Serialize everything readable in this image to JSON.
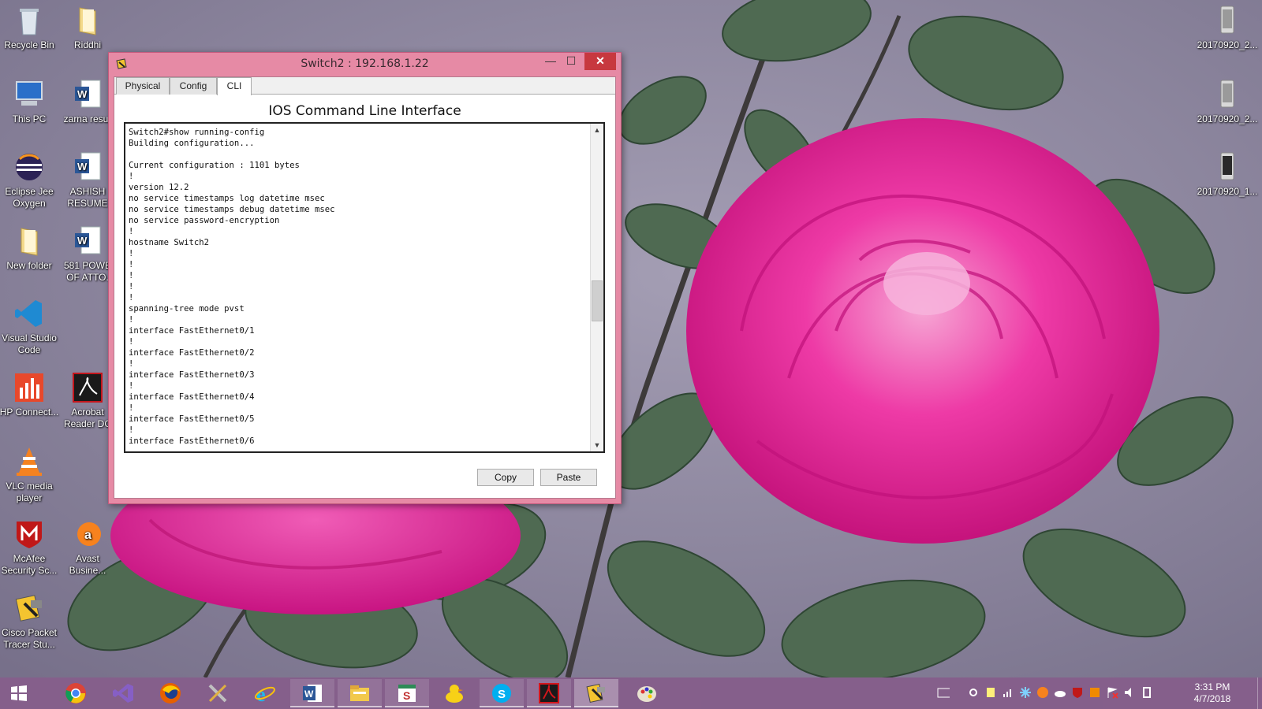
{
  "desktop": {
    "left_icons": [
      {
        "label": "Recycle Bin",
        "icon": "recycle-bin-icon"
      },
      {
        "label": "Riddhi",
        "icon": "folder-icon"
      },
      {
        "label": "This PC",
        "icon": "computer-icon"
      },
      {
        "label": "zarna resur",
        "icon": "word-document-icon"
      },
      {
        "label": "Eclipse Jee Oxygen",
        "icon": "eclipse-icon"
      },
      {
        "label": "ASHISH RESUME",
        "icon": "word-document-icon"
      },
      {
        "label": "New folder",
        "icon": "folder-icon"
      },
      {
        "label": "581 POWE OF ATTO.",
        "icon": "word-document-icon"
      },
      {
        "label": "Visual Studio Code",
        "icon": "vscode-icon"
      },
      {
        "label": "HP Connect...",
        "icon": "hp-connect-icon"
      },
      {
        "label": "Acrobat Reader DC",
        "icon": "acrobat-icon"
      },
      {
        "label": "VLC media player",
        "icon": "vlc-icon"
      },
      {
        "label": "McAfee Security Sc...",
        "icon": "mcafee-icon"
      },
      {
        "label": "Avast Busine...",
        "icon": "avast-icon"
      },
      {
        "label": "Cisco Packet Tracer Stu...",
        "icon": "packet-tracer-icon"
      }
    ],
    "right_icons": [
      {
        "label": "20170920_2...",
        "icon": "image-file-icon"
      },
      {
        "label": "20170920_2...",
        "icon": "image-file-icon"
      },
      {
        "label": "20170920_1...",
        "icon": "image-file-icon"
      }
    ]
  },
  "window": {
    "title": "Switch2 : 192.168.1.22",
    "controls": {
      "minimize": "—",
      "maximize": "☐",
      "close": "✕"
    },
    "tabs": [
      {
        "label": "Physical"
      },
      {
        "label": "Config"
      },
      {
        "label": "CLI"
      }
    ],
    "active_tab": "CLI",
    "heading": "IOS Command Line Interface",
    "cli_output": "Switch2#show running-config\nBuilding configuration...\n\nCurrent configuration : 1101 bytes\n!\nversion 12.2\nno service timestamps log datetime msec\nno service timestamps debug datetime msec\nno service password-encryption\n!\nhostname Switch2\n!\n!\n!\n!\n!\nspanning-tree mode pvst\n!\ninterface FastEthernet0/1\n!\ninterface FastEthernet0/2\n!\ninterface FastEthernet0/3\n!\ninterface FastEthernet0/4\n!\ninterface FastEthernet0/5\n!\ninterface FastEthernet0/6",
    "scroll_position": 0.55,
    "copy_label": "Copy",
    "paste_label": "Paste"
  },
  "taskbar": {
    "items": [
      {
        "name": "start-button",
        "icon": "windows-icon"
      },
      {
        "name": "chrome",
        "icon": "chrome-icon"
      },
      {
        "name": "visual-studio",
        "icon": "visual-studio-icon"
      },
      {
        "name": "firefox",
        "icon": "firefox-icon"
      },
      {
        "name": "tools",
        "icon": "tools-icon"
      },
      {
        "name": "internet-explorer",
        "icon": "internet-explorer-icon"
      },
      {
        "name": "word",
        "icon": "word-icon"
      },
      {
        "name": "file-explorer",
        "icon": "file-explorer-icon"
      },
      {
        "name": "slides",
        "icon": "slides-icon"
      },
      {
        "name": "cyberduck",
        "icon": "duck-icon"
      },
      {
        "name": "skype",
        "icon": "skype-icon"
      },
      {
        "name": "acrobat",
        "icon": "acrobat-icon"
      },
      {
        "name": "packet-tracer",
        "icon": "packet-tracer-icon"
      },
      {
        "name": "paint",
        "icon": "paint-icon"
      }
    ],
    "clock": {
      "time": "3:31 PM",
      "date": "4/7/2018"
    }
  },
  "colors": {
    "window_frame": "#e68aa5",
    "close_button": "#c7383f",
    "taskbar": "#845c8a",
    "wallpaper_base": "#8a8598",
    "rose": "#e8259a"
  }
}
